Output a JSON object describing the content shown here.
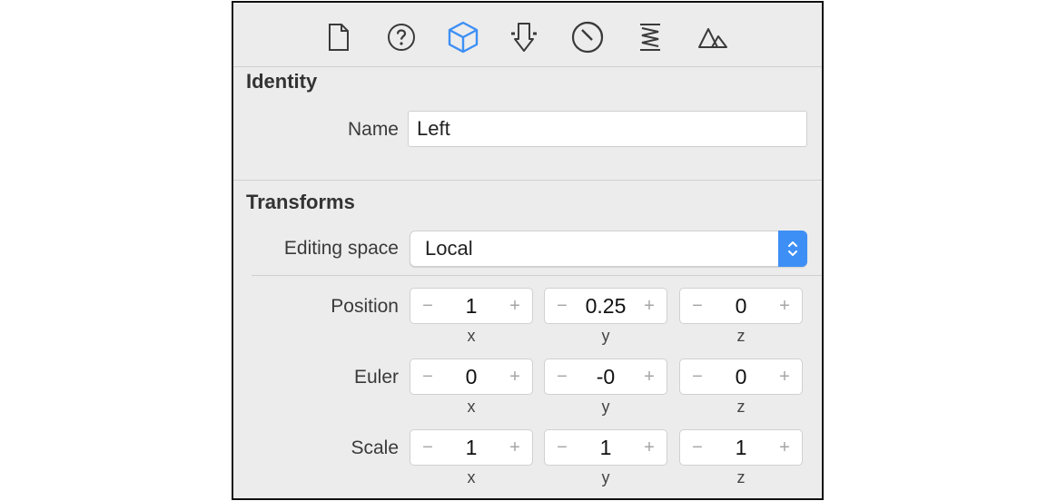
{
  "toolbar": {
    "icons": [
      "file-icon",
      "help-icon",
      "node-inspector-icon",
      "attributes-icon",
      "material-icon",
      "physics-icon",
      "scene-icon"
    ],
    "accent_color": "#3d8ff5"
  },
  "identity": {
    "title": "Identity",
    "name_label": "Name",
    "name_value": "Left"
  },
  "transforms": {
    "title": "Transforms",
    "editing_space_label": "Editing space",
    "editing_space_value": "Local",
    "position": {
      "label": "Position",
      "x": "1",
      "y": "0.25",
      "z": "0"
    },
    "euler": {
      "label": "Euler",
      "x": "0",
      "y": "-0",
      "z": "0"
    },
    "scale": {
      "label": "Scale",
      "x": "1",
      "y": "1",
      "z": "1"
    },
    "axis_labels": {
      "x": "x",
      "y": "y",
      "z": "z"
    },
    "minus_glyph": "−",
    "plus_glyph": "+"
  }
}
